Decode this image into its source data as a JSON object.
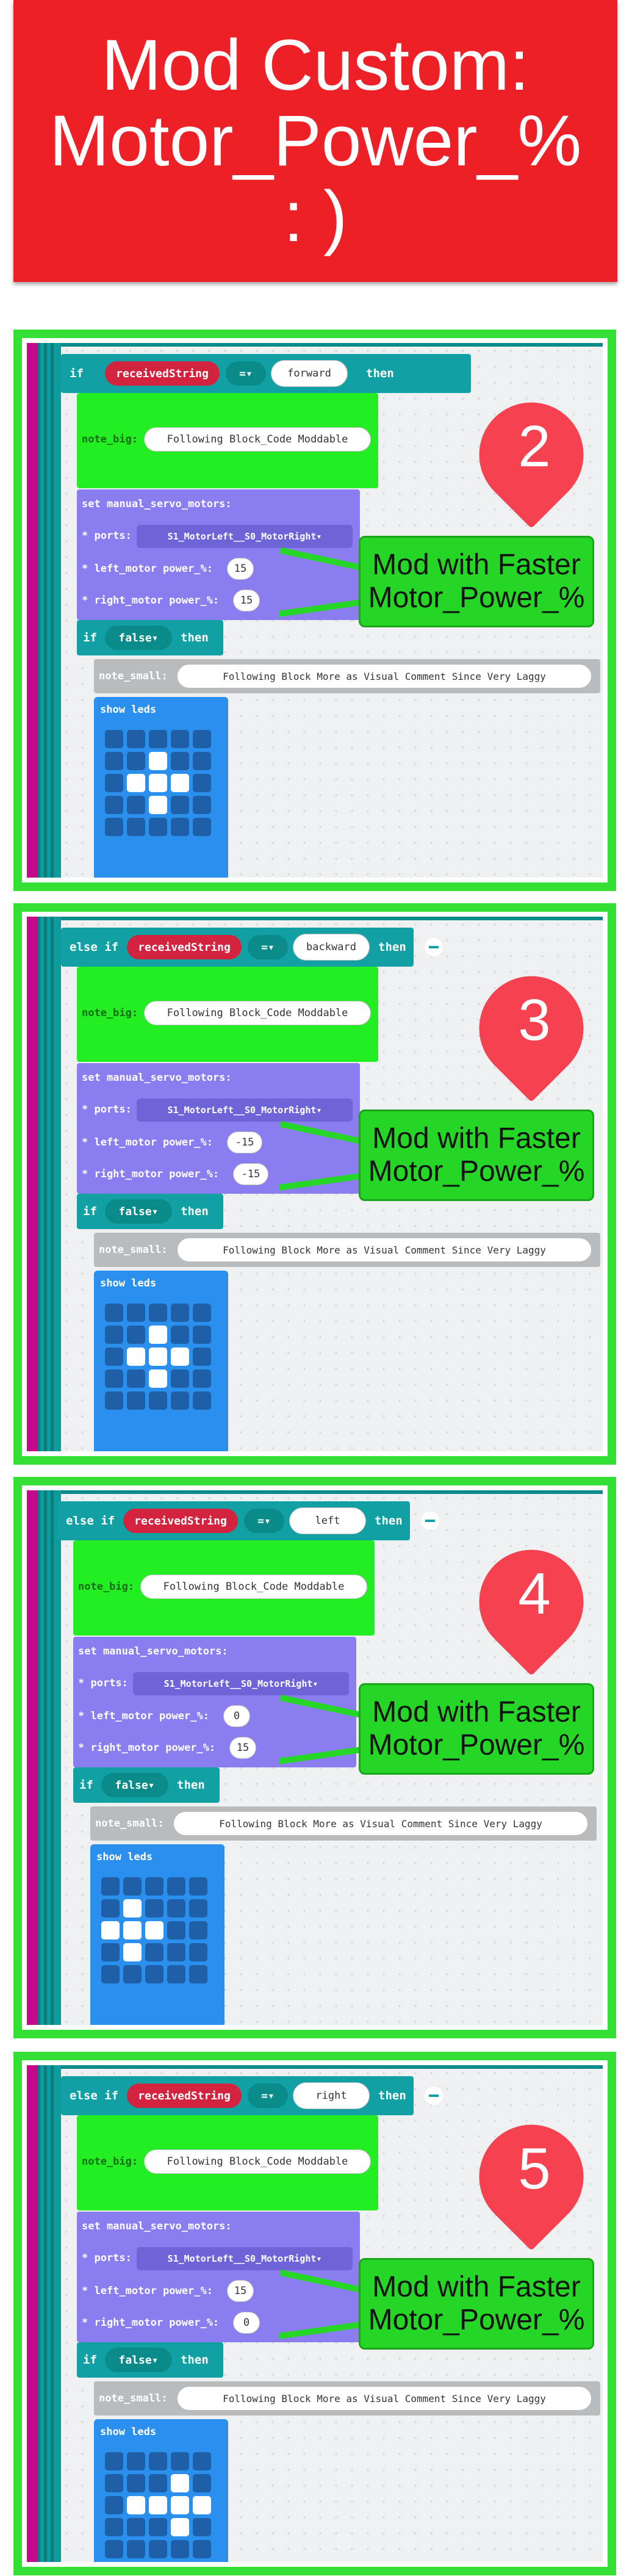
{
  "title": {
    "line1": "Mod Custom:",
    "line2": "Motor_Power_%",
    "line3": ": )"
  },
  "panels": [
    {
      "cond_keyword": "if",
      "variable": "receivedString",
      "operator": "=",
      "direction": "forward",
      "then": "then",
      "note_big_label": "note_big:",
      "note_big_text": "Following Block_Code Moddable",
      "servo_label": "set manual_servo_motors:",
      "ports_label": "* ports:",
      "ports_value": "S1_MotorLeft__S0_MotorRight",
      "left_label": "* left_motor power_%:",
      "left_value": "15",
      "right_label": "* right_motor power_%:",
      "right_value": "15",
      "if_label": "if",
      "false_label": "false",
      "then2": "then",
      "note_small_label": "note_small:",
      "note_small_text": "Following Block More as Visual Comment Since Very Laggy",
      "show_leds_label": "show leds",
      "leds": [
        0,
        0,
        0,
        0,
        0,
        0,
        0,
        1,
        0,
        0,
        0,
        1,
        1,
        1,
        0,
        0,
        0,
        1,
        0,
        0,
        0,
        0,
        0,
        0,
        0
      ],
      "marker_number": "2",
      "callout_line1": "Mod with Faster",
      "callout_line2": "Motor_Power_%"
    },
    {
      "cond_keyword": "else if",
      "variable": "receivedString",
      "operator": "=",
      "direction": "backward",
      "then": "then",
      "note_big_label": "note_big:",
      "note_big_text": "Following Block_Code Moddable",
      "servo_label": "set manual_servo_motors:",
      "ports_label": "* ports:",
      "ports_value": "S1_MotorLeft__S0_MotorRight",
      "left_label": "* left_motor power_%:",
      "left_value": "-15",
      "right_label": "* right_motor power_%:",
      "right_value": "-15",
      "if_label": "if",
      "false_label": "false",
      "then2": "then",
      "note_small_label": "note_small:",
      "note_small_text": "Following Block More as Visual Comment Since Very Laggy",
      "show_leds_label": "show leds",
      "leds": [
        0,
        0,
        0,
        0,
        0,
        0,
        0,
        1,
        0,
        0,
        0,
        1,
        1,
        1,
        0,
        0,
        0,
        1,
        0,
        0,
        0,
        0,
        0,
        0,
        0
      ],
      "marker_number": "3",
      "callout_line1": "Mod with Faster",
      "callout_line2": "Motor_Power_%"
    },
    {
      "cond_keyword": "else if",
      "variable": "receivedString",
      "operator": "=",
      "direction": "left",
      "then": "then",
      "note_big_label": "note_big:",
      "note_big_text": "Following Block_Code Moddable",
      "servo_label": "set manual_servo_motors:",
      "ports_label": "* ports:",
      "ports_value": "S1_MotorLeft__S0_MotorRight",
      "left_label": "* left_motor power_%:",
      "left_value": "0",
      "right_label": "* right_motor power_%:",
      "right_value": "15",
      "if_label": "if",
      "false_label": "false",
      "then2": "then",
      "note_small_label": "note_small:",
      "note_small_text": "Following Block More as Visual Comment Since Very Laggy",
      "show_leds_label": "show leds",
      "leds": [
        0,
        0,
        0,
        0,
        0,
        0,
        1,
        0,
        0,
        0,
        1,
        1,
        1,
        0,
        0,
        0,
        1,
        0,
        0,
        0,
        0,
        0,
        0,
        0,
        0
      ],
      "marker_number": "4",
      "callout_line1": "Mod with Faster",
      "callout_line2": "Motor_Power_%"
    },
    {
      "cond_keyword": "else if",
      "variable": "receivedString",
      "operator": "=",
      "direction": "right",
      "then": "then",
      "note_big_label": "note_big:",
      "note_big_text": "Following Block_Code Moddable",
      "servo_label": "set manual_servo_motors:",
      "ports_label": "* ports:",
      "ports_value": "S1_MotorLeft__S0_MotorRight",
      "left_label": "* left_motor power_%:",
      "left_value": "15",
      "right_label": "* right_motor power_%:",
      "right_value": "0",
      "if_label": "if",
      "false_label": "false",
      "then2": "then",
      "note_small_label": "note_small:",
      "note_small_text": "Following Block More as Visual Comment Since Very Laggy",
      "show_leds_label": "show leds",
      "leds": [
        0,
        0,
        0,
        0,
        0,
        0,
        0,
        0,
        1,
        0,
        0,
        1,
        1,
        1,
        1,
        0,
        0,
        0,
        1,
        0,
        0,
        0,
        0,
        0,
        0
      ],
      "marker_number": "5",
      "callout_line1": "Mod with Faster",
      "callout_line2": "Motor_Power_%"
    }
  ],
  "colors": {
    "banner": "#ec2026",
    "panel_border": "#35e035",
    "teal_block": "#11a0a3",
    "note_block": "#22ee22",
    "servo_block": "#8a7df0",
    "leds_block": "#2b8fee",
    "marker": "#f64150",
    "callout": "#26d626"
  }
}
